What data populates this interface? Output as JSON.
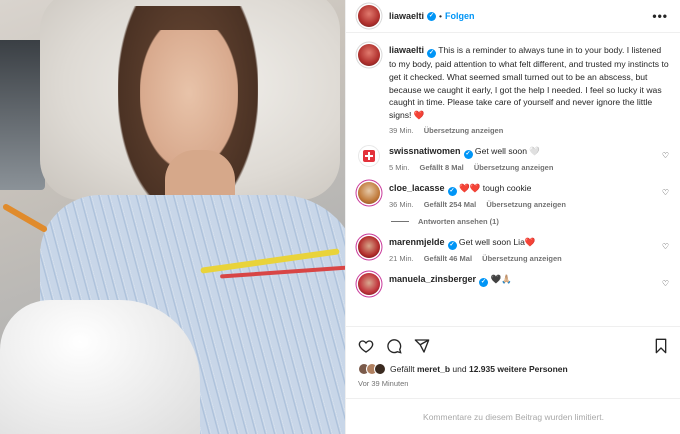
{
  "header": {
    "username": "liawaelti",
    "separator": "•",
    "follow_label": "Folgen",
    "more_icon": "more-horizontal-icon"
  },
  "caption": {
    "username": "liawaelti",
    "text": "This is a reminder to always tune in to your body. I listened to my body, paid attention to what felt different, and trusted my instincts to get it checked. What seemed small turned out to be an abscess, but because we caught it early, I got the help I needed. I feel so lucky it was caught in time. Please take care of yourself and never ignore the little signs! ❤️",
    "time": "39 Min.",
    "translate": "Übersetzung anzeigen"
  },
  "comments": [
    {
      "username": "swissnatiwomen",
      "text": "Get well soon 🤍",
      "time": "5 Min.",
      "likes": "Gefällt 8 Mal",
      "translate": "Übersetzung anzeigen"
    },
    {
      "username": "cloe_lacasse",
      "text": "❤️❤️ tough cookie",
      "time": "36 Min.",
      "likes": "Gefällt 254 Mal",
      "translate": "Übersetzung anzeigen",
      "replies": "Antworten ansehen (1)"
    },
    {
      "username": "marenmjelde",
      "text": "Get well soon Lia❤️",
      "time": "21 Min.",
      "likes": "Gefällt 46 Mal",
      "translate": "Übersetzung anzeigen"
    },
    {
      "username": "manuela_zinsberger",
      "text": "🖤🙏🏼"
    }
  ],
  "footer": {
    "liked_prefix": "Gefällt",
    "liked_user": "meret_b",
    "liked_and": "und",
    "liked_others": "12.935 weitere Personen",
    "time": "Vor 39 Minuten",
    "limited": "Kommentare zu diesem Beitrag wurden limitiert."
  },
  "colors": {
    "accent": "#0095f6",
    "muted": "#737373",
    "heart": "#ed4956"
  }
}
